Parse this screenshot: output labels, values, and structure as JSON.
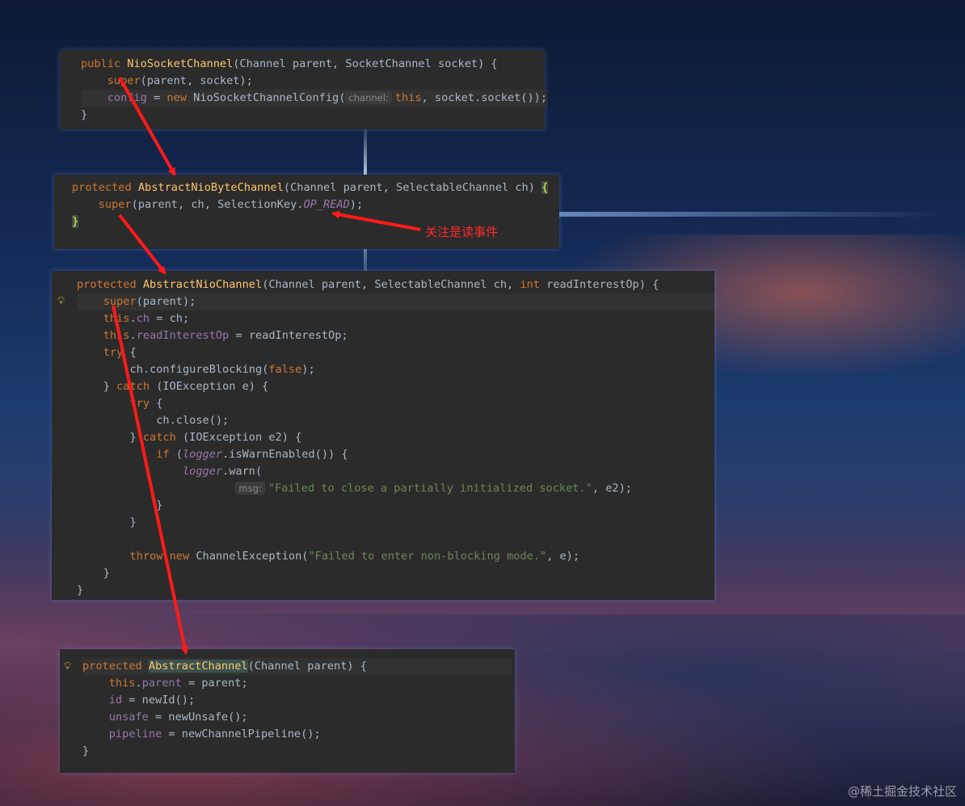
{
  "panel1": {
    "l1": [
      "public",
      "NioSocketChannel",
      "(Channel parent, SocketChannel socket) {"
    ],
    "l2": [
      "super",
      "(parent, socket);"
    ],
    "l3": [
      "config",
      " = ",
      "new",
      " NioSocketChannelConfig(",
      "channel:",
      "this",
      ", socket.socket());"
    ],
    "l4": "}"
  },
  "panel2": {
    "l1": [
      "protected",
      "AbstractNioByteChannel",
      "(Channel parent, SelectableChannel ch) ",
      "{"
    ],
    "l2": [
      "super",
      "(parent, ch, SelectionKey.",
      "OP_READ",
      ");"
    ],
    "l3": "}"
  },
  "annotation": {
    "text": "关注是读事件",
    "color": "#ff2a2a"
  },
  "panel3": {
    "l1": [
      "protected",
      "AbstractNioChannel",
      "(Channel parent, SelectableChannel ch, ",
      "int",
      " readInterestOp) {"
    ],
    "l2": [
      "super",
      "(parent);"
    ],
    "l3": [
      "this",
      ".",
      "ch",
      " = ch;"
    ],
    "l4": [
      "this",
      ".",
      "readInterestOp",
      " = readInterestOp;"
    ],
    "l5": [
      "try",
      " {"
    ],
    "l6": [
      "ch.configureBlocking(",
      "false",
      ");"
    ],
    "l7": [
      "} ",
      "catch",
      " (IOException e) {"
    ],
    "l8": [
      "try",
      " {"
    ],
    "l9": "ch.close();",
    "l10": [
      "} ",
      "catch",
      " (IOException e2) {"
    ],
    "l11": [
      "if",
      " (",
      "logger",
      ".isWarnEnabled()) {"
    ],
    "l12": [
      "logger",
      ".warn("
    ],
    "l13": [
      "msg:",
      "\"Failed to close a partially initialized socket.\"",
      ", e2);"
    ],
    "l14": "}",
    "l15": "}",
    "l16": [
      "throw",
      "new",
      " ChannelException(",
      "\"Failed to enter non-blocking mode.\"",
      ", e);"
    ],
    "l17": "}",
    "l18": "}"
  },
  "panel4": {
    "l1": [
      "protected",
      "AbstractChannel",
      "(Channel parent) {"
    ],
    "l2": [
      "this",
      ".",
      "parent",
      " = parent;"
    ],
    "l3": [
      "id",
      " = newId();"
    ],
    "l4": [
      "unsafe",
      " = newUnsafe();"
    ],
    "l5": [
      "pipeline",
      " = newChannelPipeline();"
    ],
    "l6": "}"
  },
  "icons": {
    "bulb": "lightbulb-icon"
  },
  "watermark": "@稀土掘金技术社区"
}
